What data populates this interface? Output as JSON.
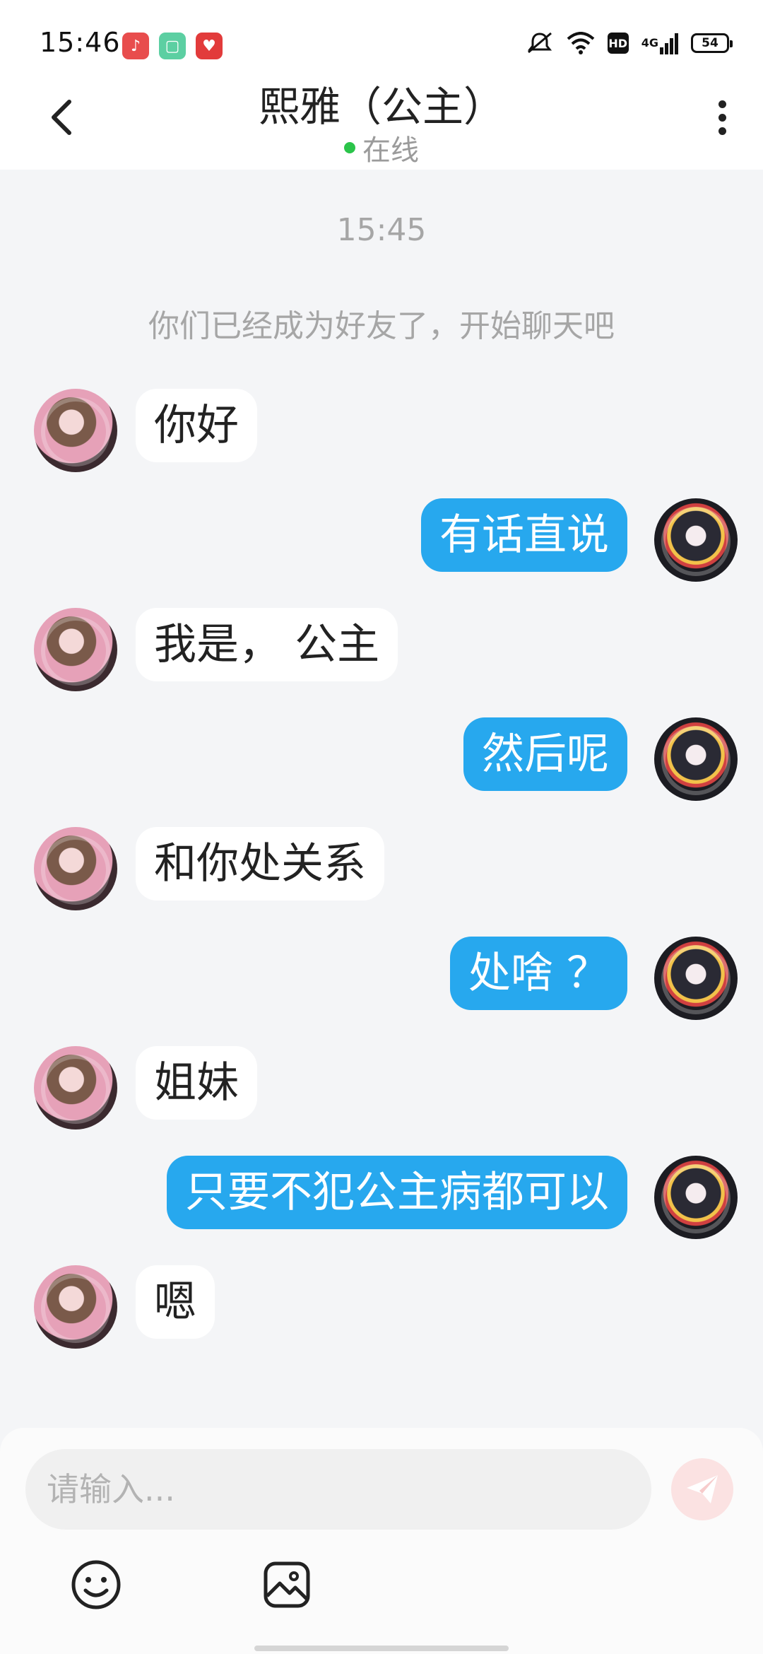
{
  "status_bar": {
    "time": "15:46",
    "network": "4G",
    "hd": "HD",
    "battery": "54"
  },
  "header": {
    "title": "熙雅（公主）",
    "status": "在线"
  },
  "chat": {
    "timestamp": "15:45",
    "system_message": "你们已经成为好友了，开始聊天吧",
    "messages": [
      {
        "side": "left",
        "text": "你好"
      },
      {
        "side": "right",
        "text": "有话直说"
      },
      {
        "side": "left",
        "text": "我是， 公主"
      },
      {
        "side": "right",
        "text": "然后呢"
      },
      {
        "side": "left",
        "text": "和你处关系"
      },
      {
        "side": "right",
        "text": "处啥 ？"
      },
      {
        "side": "left",
        "text": "姐妹"
      },
      {
        "side": "right",
        "text": "只要不犯公主病都可以"
      },
      {
        "side": "left",
        "text": "嗯"
      }
    ]
  },
  "composer": {
    "placeholder": "请输入..."
  },
  "colors": {
    "accent": "#27a8ee",
    "online": "#2bc44a",
    "send_disabled": "#fbe2e2"
  }
}
